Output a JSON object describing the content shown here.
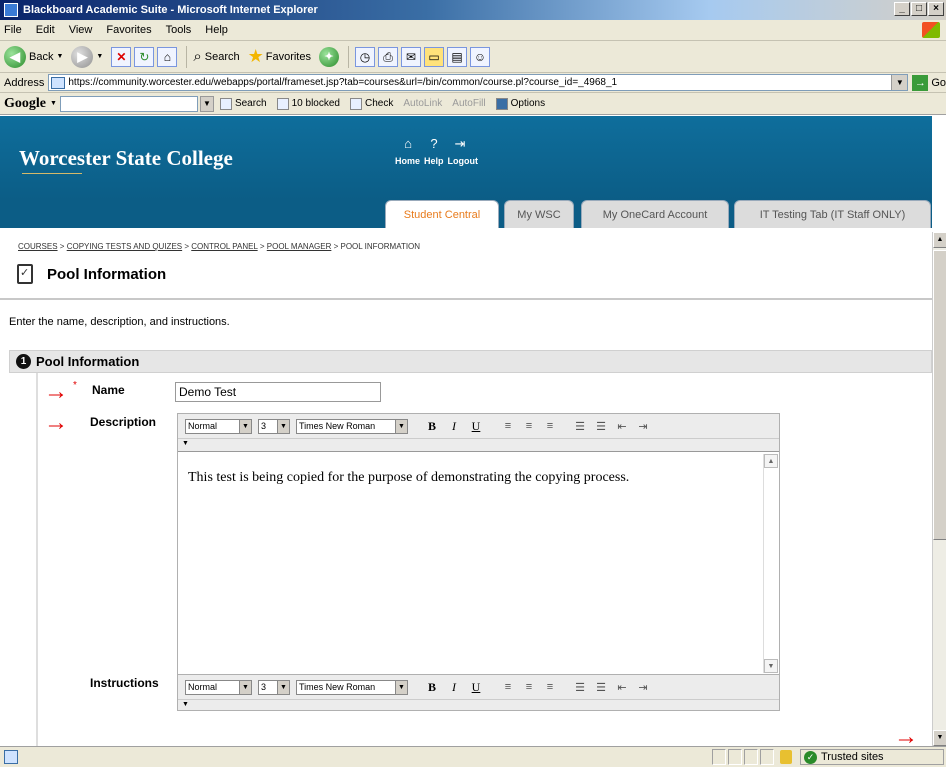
{
  "window": {
    "title": "Blackboard Academic Suite - Microsoft Internet Explorer"
  },
  "menu": [
    "File",
    "Edit",
    "View",
    "Favorites",
    "Tools",
    "Help"
  ],
  "toolbar": {
    "back": "Back",
    "search": "Search",
    "favorites": "Favorites"
  },
  "address": {
    "label": "Address",
    "url": "https://community.worcester.edu/webapps/portal/frameset.jsp?tab=courses&url=/bin/common/course.pl?course_id=_4968_1",
    "go": "Go"
  },
  "google": {
    "logo": "Google",
    "search": "Search",
    "blocked": "10 blocked",
    "check": "Check",
    "autolink": "AutoLink",
    "autofill": "AutoFill",
    "options": "Options"
  },
  "site": {
    "logo": "Worcester State College",
    "nav": {
      "home": "Home",
      "help": "Help",
      "logout": "Logout"
    },
    "tabs": [
      "Student Central",
      "My WSC",
      "My OneCard Account",
      "IT Testing Tab (IT Staff ONLY)"
    ]
  },
  "breadcrumb": [
    "COURSES",
    "COPYING TESTS AND QUIZES",
    "CONTROL PANEL",
    "POOL MANAGER",
    "POOL INFORMATION"
  ],
  "page": {
    "title": "Pool Information",
    "instructions": "Enter the name, description, and instructions.",
    "section_number": "1",
    "section_title": "Pool Information"
  },
  "form": {
    "name_label": "Name",
    "name_value": "Demo Test",
    "description_label": "Description",
    "description_text": "This test is being copied for the purpose of demonstrating the copying process.",
    "instructions_label": "Instructions",
    "required_mark": "*"
  },
  "editor": {
    "style": "Normal",
    "size": "3",
    "font": "Times New Roman",
    "bold": "B",
    "italic": "I",
    "underline": "U"
  },
  "status": {
    "zone": "Trusted sites"
  },
  "annotation_color": "#e00000"
}
